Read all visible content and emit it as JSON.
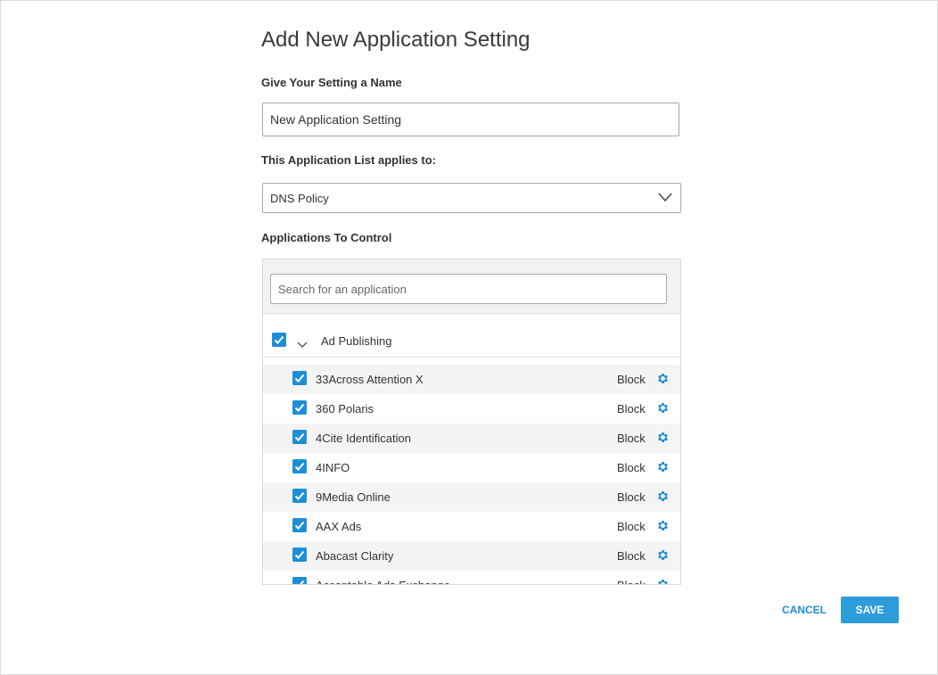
{
  "dialog": {
    "title": "Add New Application Setting",
    "name_label": "Give Your Setting a Name",
    "name_value": "New Application Setting",
    "applies_label": "This Application List applies to:",
    "applies_value": "DNS Policy",
    "apps_label": "Applications To Control",
    "search_placeholder": "Search for an application",
    "group": {
      "label": "Ad Publishing",
      "checked": true,
      "expanded": true
    },
    "apps": [
      {
        "name": "33Across Attention X",
        "action": "Block",
        "checked": true
      },
      {
        "name": "360 Polaris",
        "action": "Block",
        "checked": true
      },
      {
        "name": "4Cite Identification",
        "action": "Block",
        "checked": true
      },
      {
        "name": "4INFO",
        "action": "Block",
        "checked": true
      },
      {
        "name": "9Media Online",
        "action": "Block",
        "checked": true
      },
      {
        "name": "AAX Ads",
        "action": "Block",
        "checked": true
      },
      {
        "name": "Abacast Clarity",
        "action": "Block",
        "checked": true
      },
      {
        "name": "Acceptable Ads Exchange",
        "action": "Block",
        "checked": true
      }
    ],
    "cancel_label": "CANCEL",
    "save_label": "SAVE"
  },
  "colors": {
    "accent": "#1e8fd6",
    "save_bg": "#2d9cdb",
    "row_alt": "#f4f4f4"
  },
  "icons": [
    "checkbox-checked-icon",
    "chevron-down-icon",
    "gear-icon"
  ]
}
